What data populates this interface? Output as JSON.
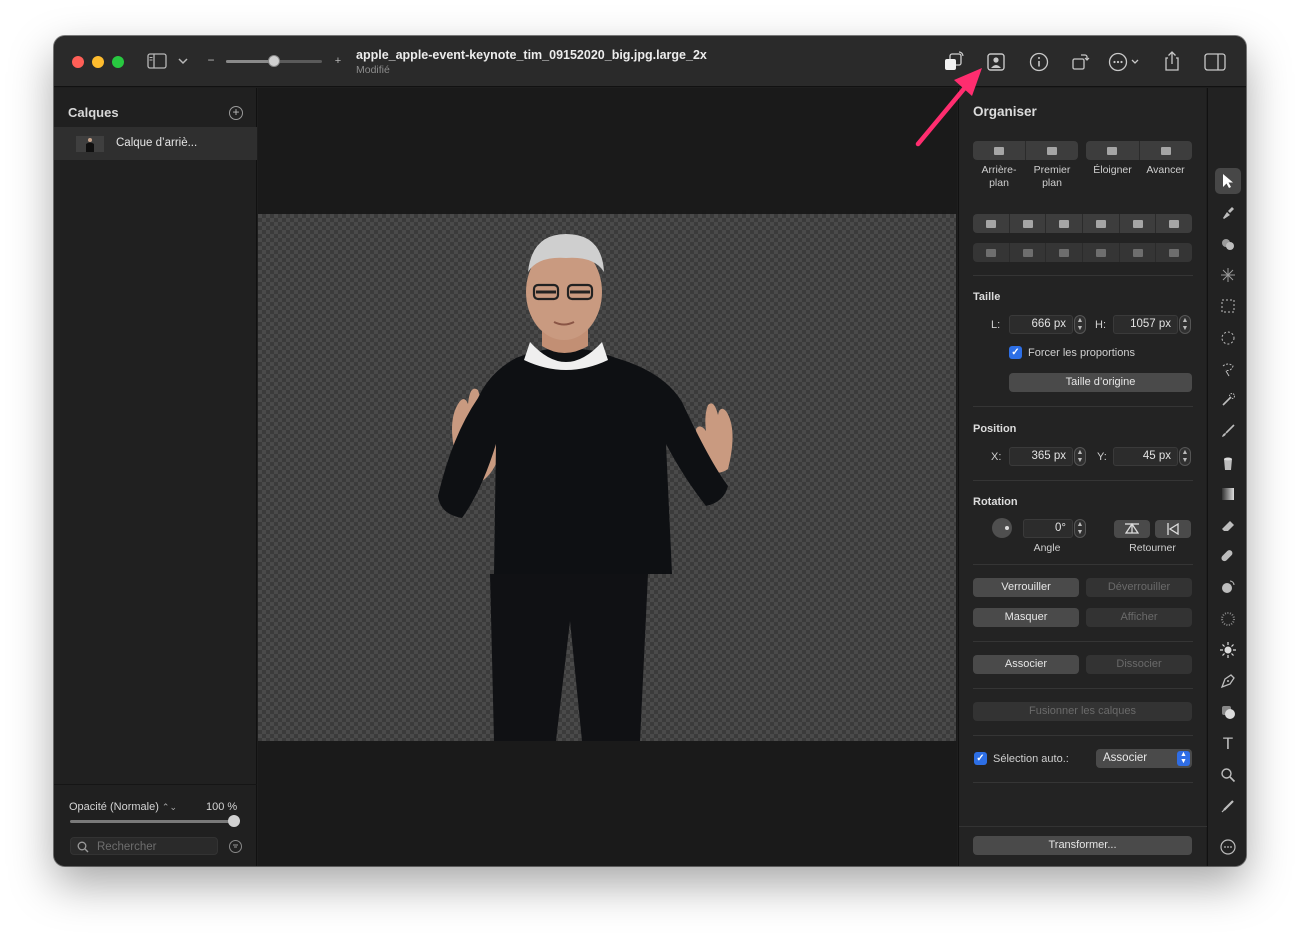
{
  "window": {
    "title": "apple_apple-event-keynote_tim_09152020_big.jpg.large_2x",
    "subtitle": "Modifié"
  },
  "titlebar": {
    "zoom_minus": "−",
    "zoom_plus": "+",
    "zoom_level": 0.5
  },
  "layers_panel": {
    "title": "Calques",
    "layers": [
      {
        "name": "Calque d’arriè..."
      }
    ],
    "opacity_label": "Opacité (Normale)",
    "opacity_value": "100 %",
    "search_placeholder": "Rechercher"
  },
  "inspector": {
    "arrange": {
      "title": "Organiser",
      "order_buttons": [
        {
          "label": "Arrière-\nplan"
        },
        {
          "label": "Premier\nplan"
        },
        {
          "label": "Éloigner"
        },
        {
          "label": "Avancer"
        }
      ]
    },
    "size": {
      "title": "Taille",
      "width_label": "L:",
      "width_value": "666 px",
      "height_label": "H:",
      "height_value": "1057 px",
      "keep_proportions_label": "Forcer les proportions",
      "keep_proportions_checked": true,
      "original_size_button": "Taille d’origine"
    },
    "position": {
      "title": "Position",
      "x_label": "X:",
      "x_value": "365 px",
      "y_label": "Y:",
      "y_value": "45 px"
    },
    "rotation": {
      "title": "Rotation",
      "angle_value": "0°",
      "angle_label": "Angle",
      "flip_label": "Retourner"
    },
    "lock_button": "Verrouiller",
    "unlock_button": "Déverrouiller",
    "hide_button": "Masquer",
    "show_button": "Afficher",
    "group_button": "Associer",
    "ungroup_button": "Dissocier",
    "merge_button": "Fusionner les calques",
    "auto_select_label": "Sélection auto.:",
    "auto_select_checked": true,
    "auto_select_value": "Associer",
    "transform_button": "Transformer..."
  },
  "colors": {
    "accent": "#2d6fe6",
    "annotation_arrow": "#ff2d6f",
    "window_bg": "#1e1e1e"
  }
}
